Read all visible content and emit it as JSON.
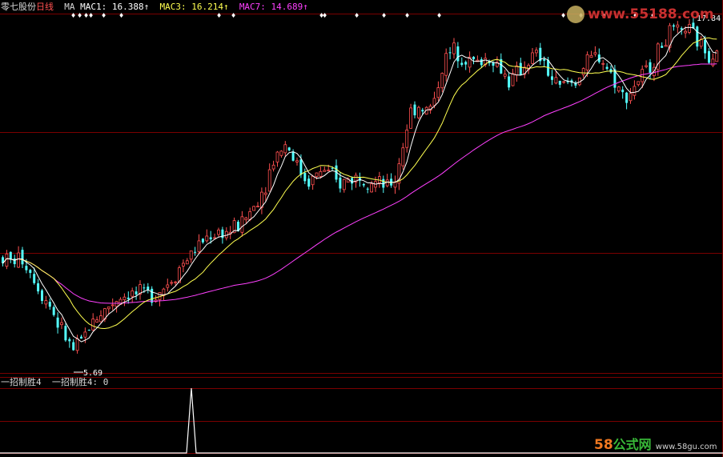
{
  "header": {
    "stock_name": "零七股份",
    "period": "日线",
    "ma_label": "MA",
    "mac1": "MAC1: 16.388↑",
    "mac3": "MAC3: 16.214↑",
    "mac7": "MAC7: 14.689↑",
    "high_value": "17.84"
  },
  "main_chart": {
    "low_label": "5.69"
  },
  "sub_chart": {
    "indicator_name": "一招制胜4",
    "indicator_value_text": "一招制胜4: 0"
  },
  "watermarks": {
    "top_site": "www.55188.com",
    "bottom_brand_num": "58",
    "bottom_brand_text": "公式网",
    "bottom_site": "www.58gu.com"
  },
  "colors": {
    "background": "#000000",
    "up_candle": "#ff5050",
    "down_candle": "#54ffff",
    "mac1_line": "#ffffff",
    "mac3_line": "#ffff50",
    "mac7_line": "#ff40ff",
    "grid": "#7a0000",
    "signal_line": "#ffffff"
  },
  "chart_data": {
    "type": "candlestick",
    "price_range": [
      5.0,
      18.0
    ],
    "low_price": 5.69,
    "high_price": 17.84,
    "mac1_last": 16.388,
    "mac3_last": 16.214,
    "mac7_last": 14.689,
    "signal_range": [
      0,
      1
    ],
    "signal_values": [
      0,
      0,
      0,
      1,
      0,
      0,
      0
    ],
    "signal_spike_index": 3
  }
}
